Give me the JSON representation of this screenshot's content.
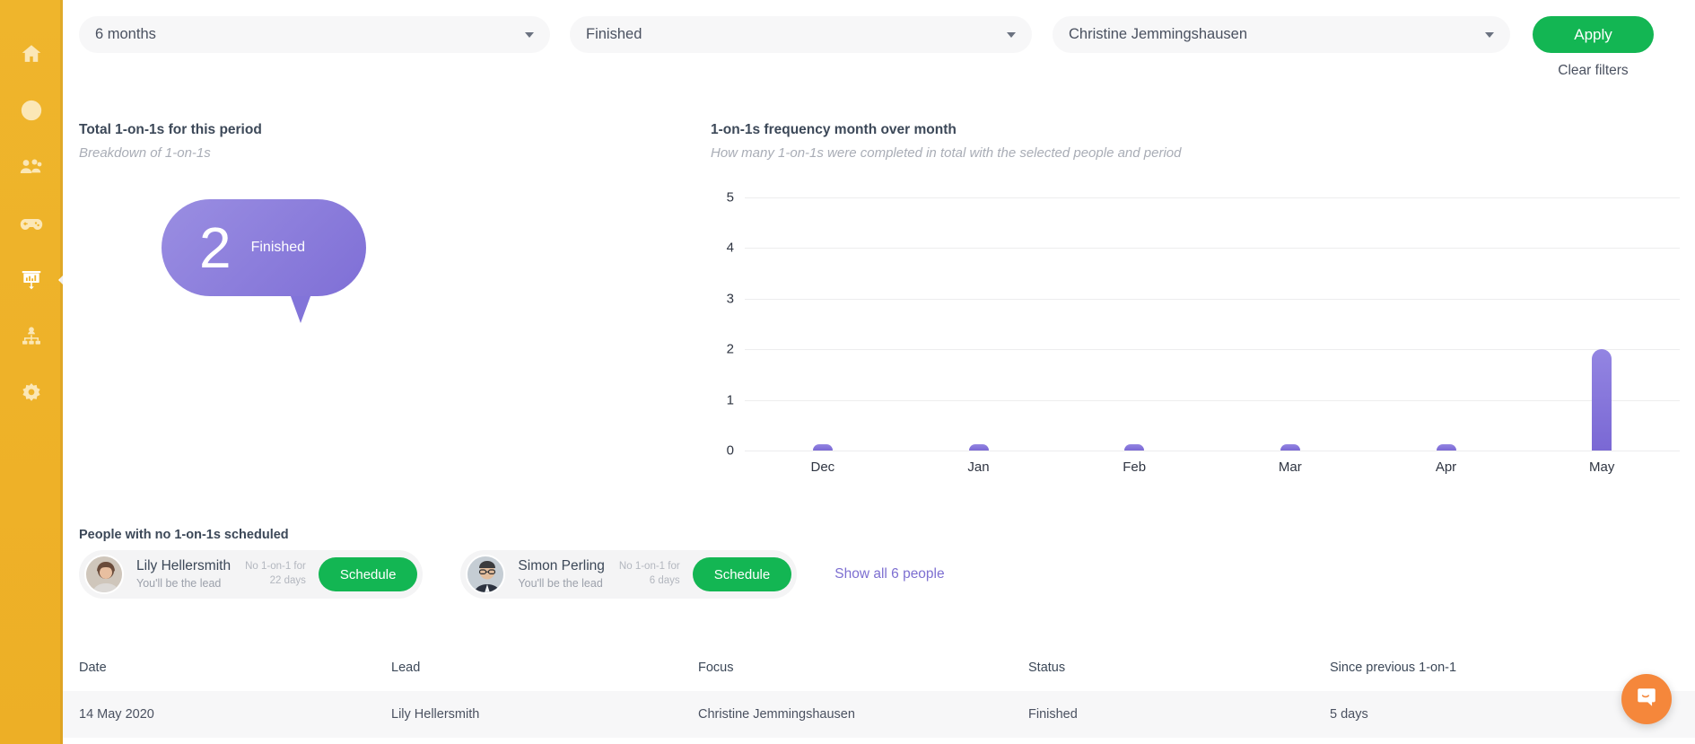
{
  "sidebar": {
    "items": [
      {
        "name": "home",
        "icon": "home-icon",
        "active": false
      },
      {
        "name": "onboarding",
        "icon": "arrow-circle-right-icon",
        "active": false
      },
      {
        "name": "people",
        "icon": "people-group-icon",
        "active": false
      },
      {
        "name": "engagement",
        "icon": "gamepad-icon",
        "active": false
      },
      {
        "name": "reports",
        "icon": "presentation-chart-icon",
        "active": true
      },
      {
        "name": "org-chart",
        "icon": "org-chart-icon",
        "active": false
      },
      {
        "name": "settings",
        "icon": "gear-icon",
        "active": false
      }
    ]
  },
  "filters": {
    "period": {
      "value": "6 months"
    },
    "status": {
      "value": "Finished"
    },
    "person": {
      "value": "Christine Jemmingshausen"
    },
    "apply_label": "Apply",
    "clear_label": "Clear filters"
  },
  "panels": {
    "total": {
      "title": "Total 1-on-1s for this period",
      "subtitle": "Breakdown of 1-on-1s",
      "bubble_value": "2",
      "bubble_label": "Finished"
    },
    "frequency": {
      "title": "1-on-1s frequency month over month",
      "subtitle": "How many 1-on-1s were completed in total with the selected people and period"
    }
  },
  "chart_data": {
    "type": "bar",
    "title": "1-on-1s frequency month over month",
    "subtitle": "How many 1-on-1s were completed in total with the selected people and period",
    "categories": [
      "Dec",
      "Jan",
      "Feb",
      "Mar",
      "Apr",
      "May"
    ],
    "values": [
      0,
      0,
      0,
      0,
      0,
      2
    ],
    "yticks": [
      0,
      1,
      2,
      3,
      4,
      5
    ],
    "ylim": [
      0,
      5
    ],
    "xlabel": "",
    "ylabel": "",
    "grid": true,
    "legend": "none",
    "bar_color": "#8878DB"
  },
  "people_section": {
    "heading": "People with no 1-on-1s scheduled",
    "people": [
      {
        "name": "Lily Hellersmith",
        "role": "You'll be the lead",
        "meta_line1": "No 1-on-1 for",
        "meta_line2": "22 days",
        "action_label": "Schedule",
        "avatar": "avatar-woman"
      },
      {
        "name": "Simon Perling",
        "role": "You'll be the lead",
        "meta_line1": "No 1-on-1 for",
        "meta_line2": "6 days",
        "action_label": "Schedule",
        "avatar": "avatar-man"
      }
    ],
    "show_all_label": "Show all 6 people"
  },
  "table": {
    "columns": [
      "Date",
      "Lead",
      "Focus",
      "Status",
      "Since previous 1-on-1"
    ],
    "rows": [
      {
        "date": "14 May 2020",
        "lead": "Lily Hellersmith",
        "focus": "Christine Jemmingshausen",
        "status": "Finished",
        "since": "5 days"
      }
    ]
  },
  "chat": {
    "icon": "chat-bubble-icon"
  },
  "colors": {
    "sidebar": "#EFB42A",
    "accent_green": "#13B653",
    "accent_purple": "#8878DB",
    "chat_orange": "#F5873B"
  }
}
